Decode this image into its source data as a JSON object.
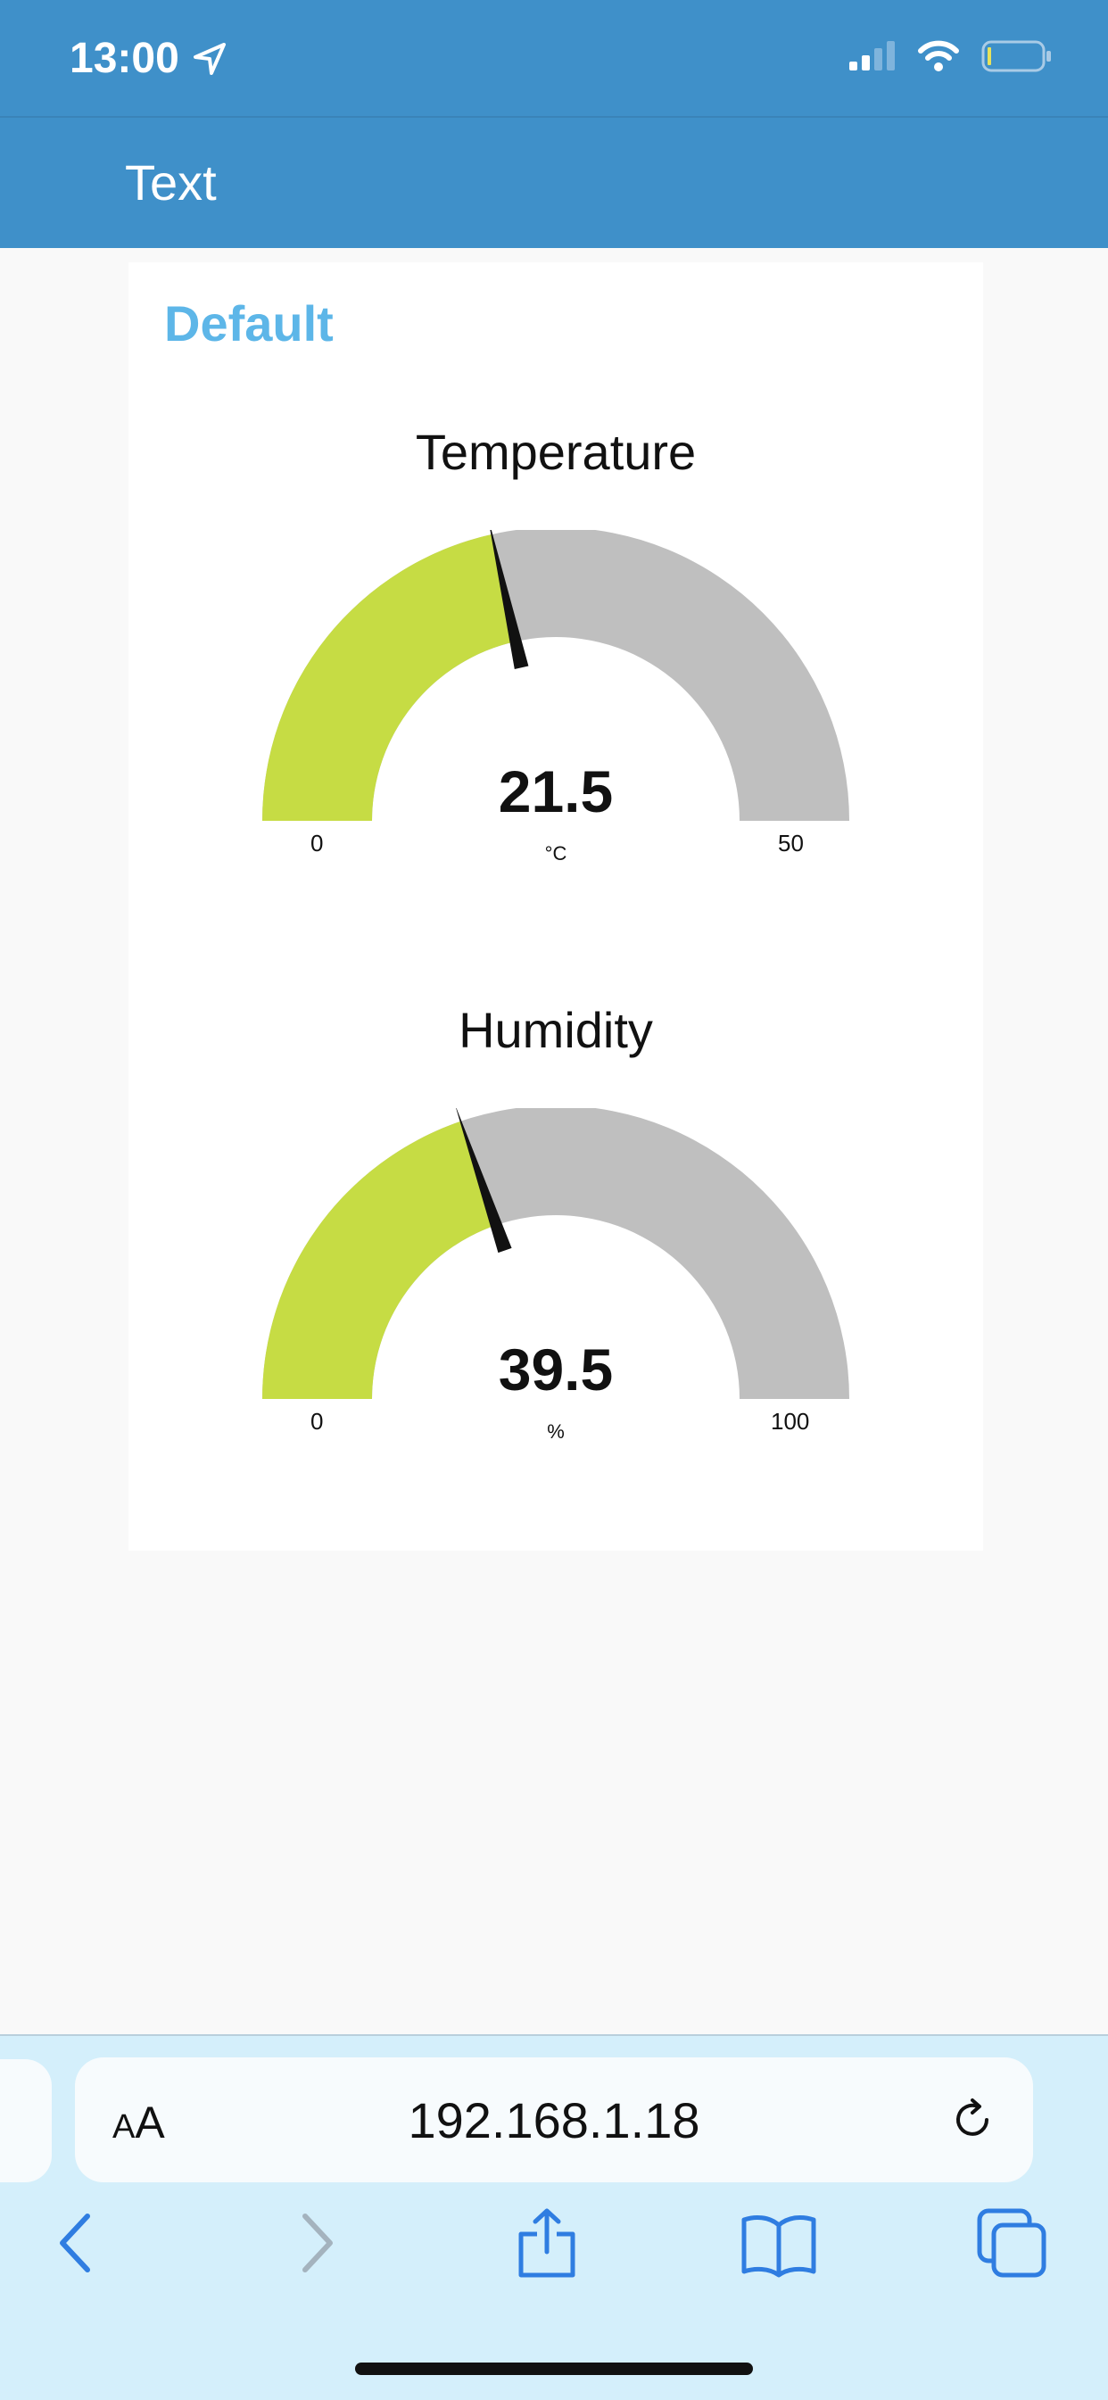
{
  "status_bar": {
    "time": "13:00"
  },
  "header": {
    "title": "Text"
  },
  "group": {
    "title": "Default"
  },
  "gauges": [
    {
      "title": "Temperature",
      "value": "21.5",
      "unit": "°C",
      "min": "0",
      "max": "50",
      "fraction": 0.43
    },
    {
      "title": "Humidity",
      "value": "39.5",
      "unit": "%",
      "min": "0",
      "max": "100",
      "fraction": 0.395
    }
  ],
  "colors": {
    "accent": "#3f90c9",
    "gauge_fill": "#c6dc44",
    "gauge_track": "#bfbfbf",
    "group_title": "#5db6e8"
  },
  "browser": {
    "aa_label_small": "A",
    "aa_label_large": "A",
    "url": "192.168.1.18"
  },
  "icons": [
    "location-arrow-icon",
    "signal-icon",
    "wifi-icon",
    "battery-icon",
    "reload-icon",
    "back-icon",
    "forward-icon",
    "share-icon",
    "bookmarks-icon",
    "tabs-icon"
  ]
}
